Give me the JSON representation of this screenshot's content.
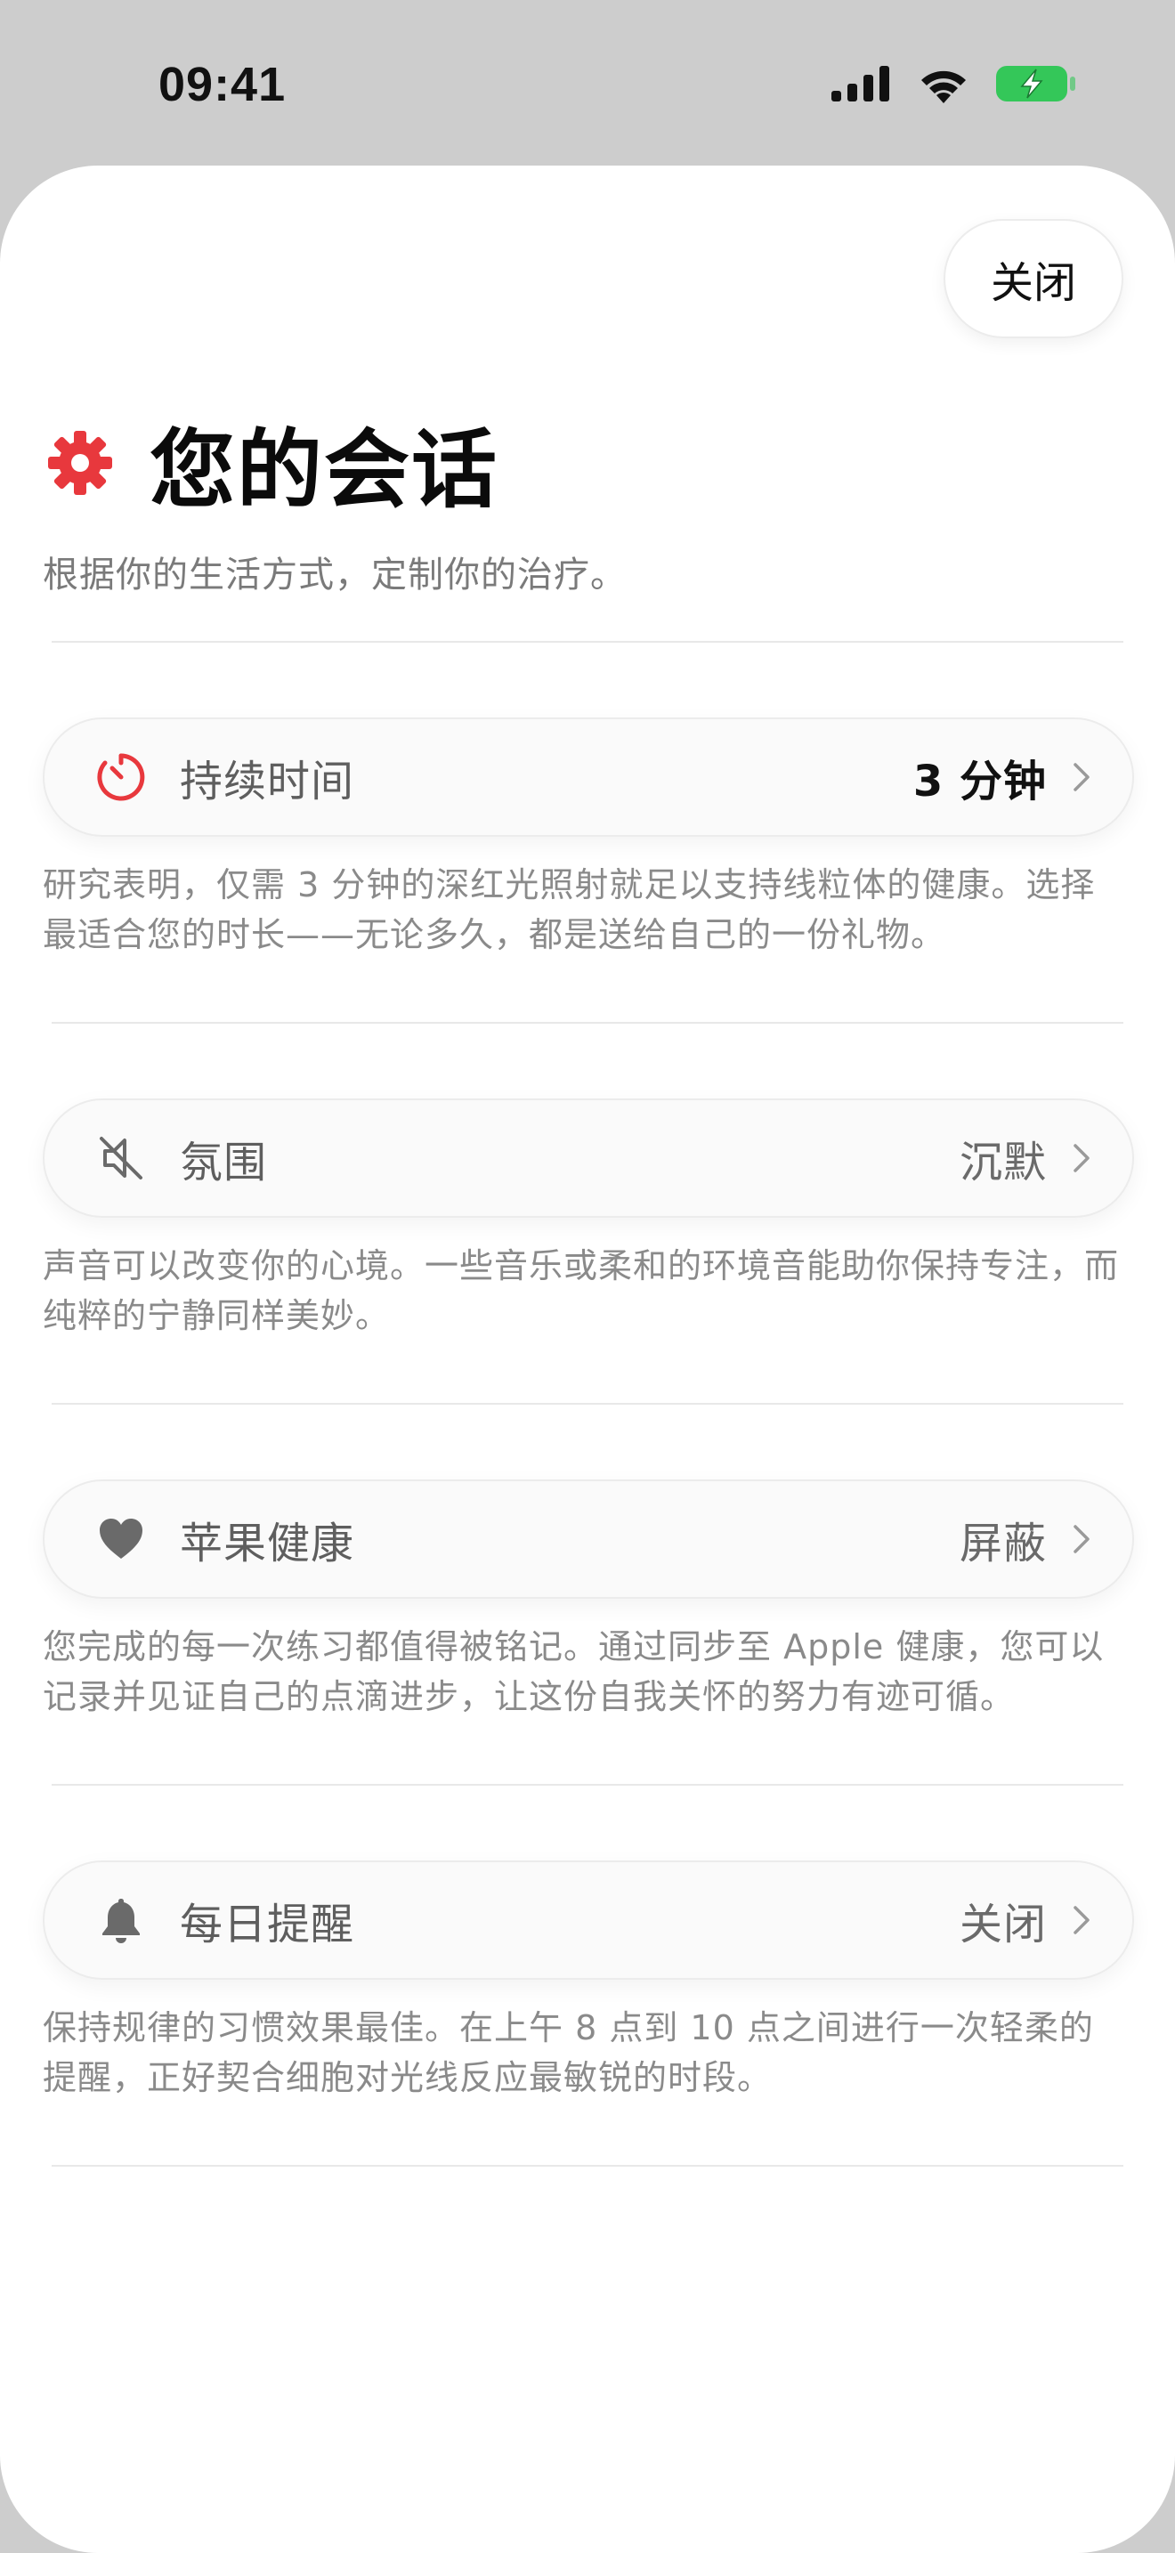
{
  "status_bar": {
    "time": "09:41"
  },
  "header": {
    "close_label": "关闭",
    "title": "您的会话",
    "subtitle": "根据你的生活方式，定制你的治疗。"
  },
  "settings": [
    {
      "label": "持续时间",
      "value": "3 分钟",
      "icon": "timer-icon",
      "description": "研究表明，仅需 3 分钟的深红光照射就足以支持线粒体的健康。选择最适合您的时长——无论多久，都是送给自己的一份礼物。"
    },
    {
      "label": "氛围",
      "value": "沉默",
      "icon": "speaker-muted-icon",
      "description": "声音可以改变你的心境。一些音乐或柔和的环境音能助你保持专注，而纯粹的宁静同样美妙。"
    },
    {
      "label": "苹果健康",
      "value": "屏蔽",
      "icon": "heart-icon",
      "description": "您完成的每一次练习都值得被铭记。通过同步至 Apple 健康，您可以记录并见证自己的点滴进步，让这份自我关怀的努力有迹可循。"
    },
    {
      "label": "每日提醒",
      "value": "关闭",
      "icon": "bell-icon",
      "description": "保持规律的习惯效果最佳。在上午 8 点到 10 点之间进行一次轻柔的提醒，正好契合细胞对光线反应最敏锐的时段。"
    }
  ],
  "colors": {
    "accent": "#e8383d",
    "battery": "#34c759",
    "background": "#cdcdcd",
    "sheet": "#ffffff"
  }
}
